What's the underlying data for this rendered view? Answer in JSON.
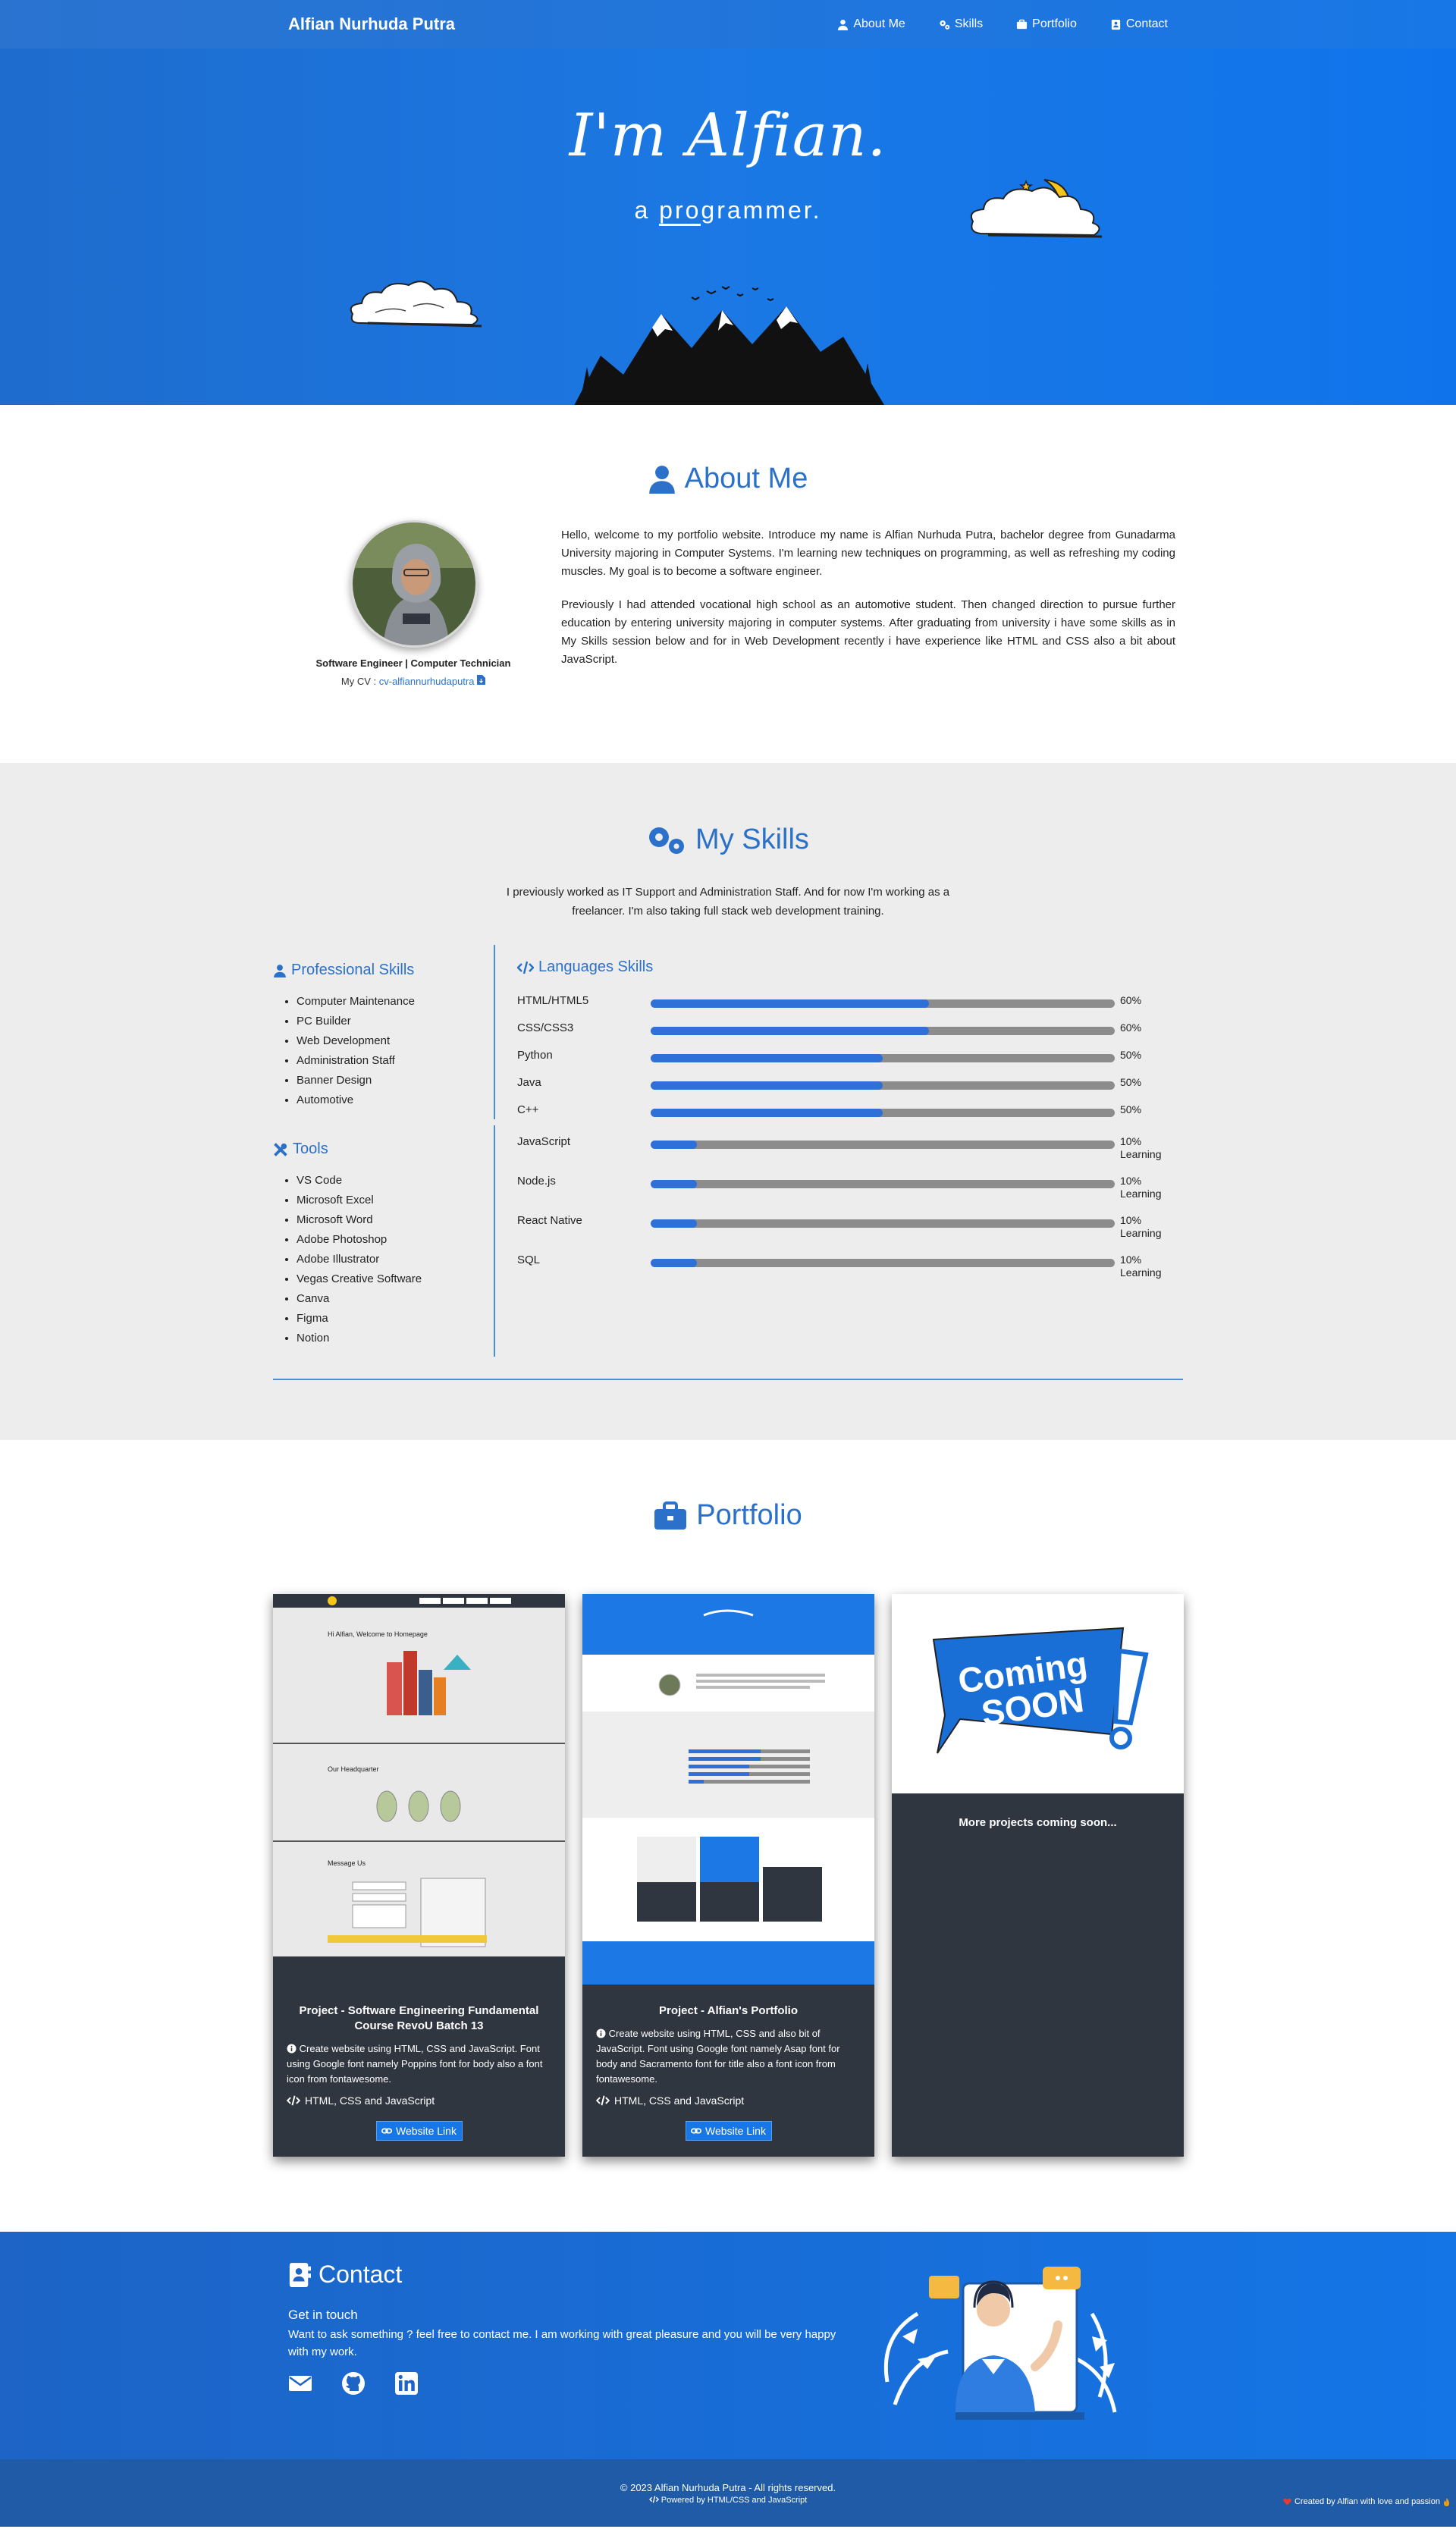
{
  "nav": {
    "brand": "Alfian Nurhuda Putra",
    "links": [
      "About Me",
      "Skills",
      "Portfolio",
      "Contact"
    ]
  },
  "hero": {
    "title": "I'm Alfian.",
    "subtitle_pre": "a ",
    "subtitle_ul": "pro",
    "subtitle_post": "grammer."
  },
  "about": {
    "title": "About Me",
    "role": "Software Engineer | Computer Technician",
    "cv_label": "My CV : ",
    "cv_link": "cv-alfiannurhudaputra",
    "p1": "Hello, welcome to my portfolio website. Introduce my name is Alfian Nurhuda Putra, bachelor degree from Gunadarma University majoring in Computer Systems. I'm learning new techniques on programming, as well as refreshing my coding muscles. My goal is to become a software engineer.",
    "p2": "Previously I had attended vocational high school as an automotive student. Then changed direction to pursue further education by entering university majoring in computer systems. After graduating from university i have some skills as in My Skills session below and for in Web Development recently i have experience like HTML and CSS also a bit about JavaScript."
  },
  "skills": {
    "title": "My Skills",
    "intro": "I previously worked as IT Support and Administration Staff. And for now I'm working as a freelancer. I'm also taking full stack web development training.",
    "professional_title": "Professional Skills",
    "professional": [
      "Computer Maintenance",
      "PC Builder",
      "Web Development",
      "Administration Staff",
      "Banner Design",
      "Automotive"
    ],
    "tools_title": "Tools",
    "tools": [
      "VS Code",
      "Microsoft Excel",
      "Microsoft Word",
      "Adobe Photoshop",
      "Adobe Illustrator",
      "Vegas Creative Software",
      "Canva",
      "Figma",
      "Notion"
    ],
    "languages_title": "Languages Skills",
    "languages": [
      {
        "name": "HTML/HTML5",
        "level": 60,
        "pct": "60%",
        "note": ""
      },
      {
        "name": "CSS/CSS3",
        "level": 60,
        "pct": "60%",
        "note": ""
      },
      {
        "name": "Python",
        "level": 50,
        "pct": "50%",
        "note": ""
      },
      {
        "name": "Java",
        "level": 50,
        "pct": "50%",
        "note": ""
      },
      {
        "name": "C++",
        "level": 50,
        "pct": "50%",
        "note": ""
      },
      {
        "name": "JavaScript",
        "level": 10,
        "pct": "10%",
        "note": "Learning"
      },
      {
        "name": "Node.js",
        "level": 10,
        "pct": "10%",
        "note": "Learning"
      },
      {
        "name": "React Native",
        "level": 10,
        "pct": "10%",
        "note": "Learning"
      },
      {
        "name": "SQL",
        "level": 10,
        "pct": "10%",
        "note": "Learning"
      }
    ]
  },
  "portfolio": {
    "title": "Portfolio",
    "cards": [
      {
        "title": "Project - Software Engineering Fundamental Course RevoU Batch 13",
        "desc": "Create website using HTML, CSS and JavaScript. Font using Google font namely Poppins font for body also a font icon from fontawesome.",
        "tech": "HTML, CSS and JavaScript",
        "button": "Website Link",
        "shot_heading": "Hi Alfian, Welcome to Homepage",
        "shot_section2": "Our Headquarter",
        "shot_section3": "Message Us"
      },
      {
        "title": "Project - Alfian's Portfolio",
        "desc": "Create website using HTML, CSS and also bit of JavaScript. Font using Google font namely Asap font for body and Sacramento font for title also a font icon from fontawesome.",
        "tech": "HTML, CSS and JavaScript",
        "button": "Website Link"
      }
    ],
    "coming_top": "Coming",
    "coming_bottom": "SOON",
    "coming_text": "More projects coming soon..."
  },
  "contact": {
    "title": "Contact",
    "subtitle": "Get in touch",
    "desc": "Want to ask something ? feel free to contact me. I am working with great pleasure and you will be very happy with my work."
  },
  "footer": {
    "copyright": "© 2023 Alfian Nurhuda Putra - All rights reserved.",
    "powered": "Powered by HTML/CSS and JavaScript",
    "made_by": "Created by Alfian with love and passion"
  },
  "colors": {
    "primary": "#1877e6",
    "accent_text": "#2b71c9",
    "card_bg": "#2f3640",
    "bar_fill": "#2e6fd8",
    "bar_track": "#8c8c8c"
  }
}
